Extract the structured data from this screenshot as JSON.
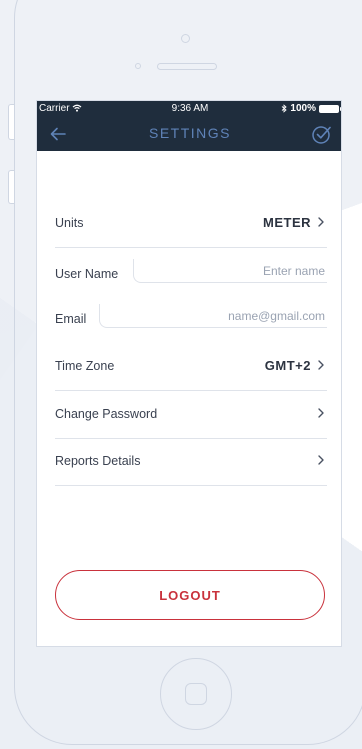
{
  "status": {
    "carrier": "Carrier",
    "time": "9:36 AM",
    "battery": "100%"
  },
  "header": {
    "title": "SETTINGS"
  },
  "settings": {
    "units": {
      "label": "Units",
      "value": "METER"
    },
    "user_name": {
      "label": "User Name",
      "placeholder": "Enter name"
    },
    "email": {
      "label": "Email",
      "placeholder": "name@gmail.com"
    },
    "time_zone": {
      "label": "Time Zone",
      "value": "GMT+2"
    },
    "change_password": {
      "label": "Change Password"
    },
    "reports_details": {
      "label": "Reports Details"
    }
  },
  "actions": {
    "logout_label": "LOGOUT"
  },
  "colors": {
    "nav_background": "#1f2d3d",
    "nav_title": "#5f83b8",
    "logout_accent": "#c9323c"
  },
  "icons": {
    "back": "arrow-left-icon",
    "confirm": "check-circle-icon",
    "chevron": "chevron-right-icon",
    "wifi": "wifi-icon",
    "bluetooth": "bluetooth-icon",
    "battery": "battery-icon"
  }
}
